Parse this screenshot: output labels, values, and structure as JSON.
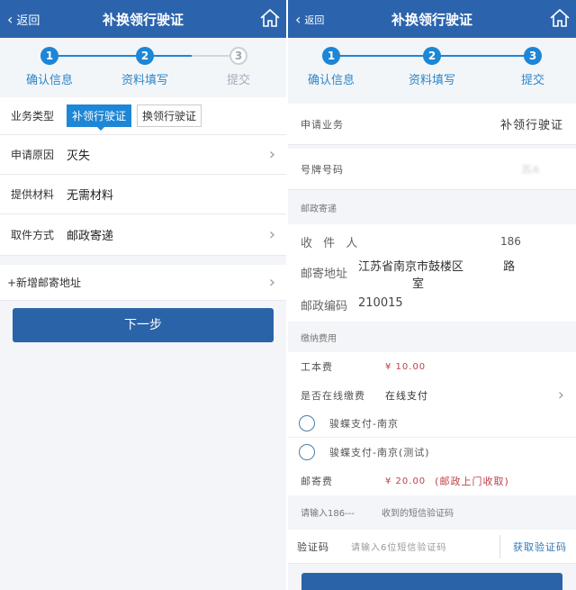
{
  "left": {
    "header": {
      "back": "返回",
      "title": "补换领行驶证"
    },
    "steps": [
      {
        "num": "1",
        "label": "确认信息"
      },
      {
        "num": "2",
        "label": "资料填写"
      },
      {
        "num": "3",
        "label": "提交"
      }
    ],
    "business_type": {
      "label": "业务类型",
      "options": [
        "补领行驶证",
        "换领行驶证"
      ]
    },
    "rows": [
      {
        "label": "申请原因",
        "value": "灭失"
      },
      {
        "label": "提供材料",
        "value": "无需材料"
      },
      {
        "label": "取件方式",
        "value": "邮政寄递"
      }
    ],
    "add_address": "+新增邮寄地址",
    "next_button": "下一步"
  },
  "right": {
    "header": {
      "back": "返回",
      "title": "补换领行驶证"
    },
    "steps": [
      {
        "num": "1",
        "label": "确认信息"
      },
      {
        "num": "2",
        "label": "资料填写"
      },
      {
        "num": "3",
        "label": "提交"
      }
    ],
    "apply": {
      "label": "申请业务",
      "value": "补领行驶证"
    },
    "plate": {
      "label": "号牌号码",
      "value": "苏A"
    },
    "postal_section": "邮政寄递",
    "recipient": {
      "label": "收 件 人",
      "phone": "186"
    },
    "address": {
      "label": "邮寄地址",
      "value": "江苏省南京市鼓楼区",
      "road": "路",
      "room": "室"
    },
    "zip": {
      "label": "邮政编码",
      "value": "210015"
    },
    "fee_section": "缴纳费用",
    "cost": {
      "label": "工本费",
      "value": "¥ 10.00"
    },
    "online": {
      "label": "是否在线缴费",
      "value": "在线支付"
    },
    "pay_options": [
      "骏蝶支付-南京",
      "骏蝶支付-南京(测试)"
    ],
    "postage": {
      "label": "邮寄费",
      "value": "¥ 20.00",
      "note": "(邮政上门收取)"
    },
    "sms_hint": {
      "prefix": "请输入186---",
      "suffix": "收到的短信验证码"
    },
    "code": {
      "label": "验证码",
      "placeholder": "请输入6位短信验证码",
      "get": "获取验证码"
    }
  }
}
